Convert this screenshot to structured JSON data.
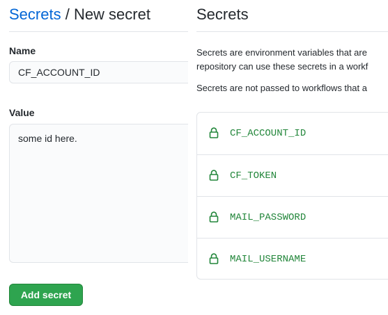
{
  "form": {
    "breadcrumb_link": "Secrets",
    "breadcrumb_separator": " / ",
    "breadcrumb_current": "New secret",
    "name_label": "Name",
    "name_value": "CF_ACCOUNT_ID",
    "value_label": "Value",
    "value_text": "some id here.",
    "submit_label": "Add secret"
  },
  "panel": {
    "title": "Secrets",
    "description_line1": "Secrets are environment variables that are",
    "description_line2": "repository can use these secrets in a workf",
    "description_line3": "Secrets are not passed to workflows that a"
  },
  "secrets": [
    {
      "name": "CF_ACCOUNT_ID",
      "icon": "lock-icon"
    },
    {
      "name": "CF_TOKEN",
      "icon": "lock-icon"
    },
    {
      "name": "MAIL_PASSWORD",
      "icon": "lock-icon"
    },
    {
      "name": "MAIL_USERNAME",
      "icon": "lock-icon"
    }
  ],
  "colors": {
    "link": "#0366d6",
    "secret_name": "#22863a",
    "button_bg": "#2ea44f",
    "border": "#e1e4e8"
  }
}
